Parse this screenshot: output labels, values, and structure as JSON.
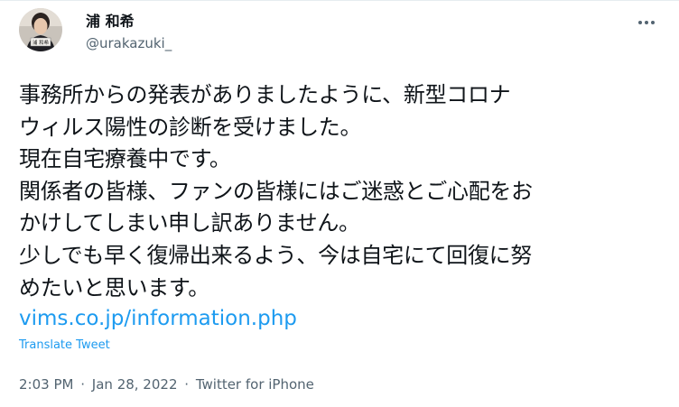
{
  "author": {
    "display_name": "浦 和希",
    "handle": "@urakazuki_",
    "avatar_badge": "浦 和希"
  },
  "more_icon": "more-horizontal-icon",
  "tweet": {
    "lines": [
      "事務所からの発表がありましたように、新型コロナ",
      "ウィルス陽性の診断を受けました。",
      "現在自宅療養中です。",
      "関係者の皆様、ファンの皆様にはご迷惑とご心配をお",
      "かけしてしまい申し訳ありません。",
      "少しでも早く復帰出来るよう、今は自宅にて回復に努",
      "めたいと思います。"
    ],
    "link": "vims.co.jp/information.php",
    "translate_label": "Translate Tweet"
  },
  "meta": {
    "time": "2:03 PM",
    "separator": "·",
    "date": "Jan 28, 2022",
    "source": "Twitter for iPhone"
  },
  "colors": {
    "accent": "#1d9bf0",
    "secondary_text": "#536471",
    "primary_text": "#0f1419"
  }
}
